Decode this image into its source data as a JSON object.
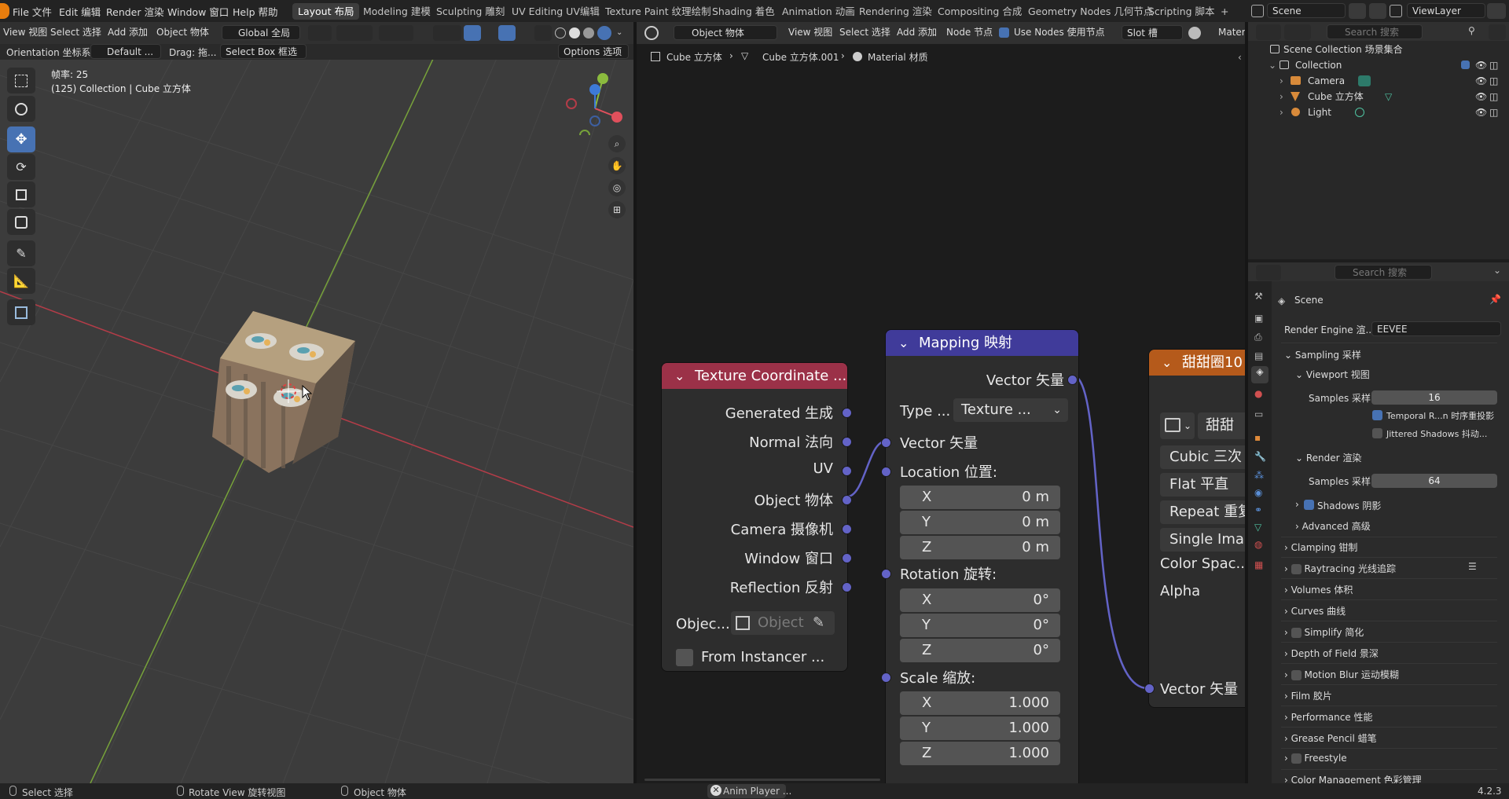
{
  "topbar": {
    "menus": [
      "File 文件",
      "Edit 编辑",
      "Render 渲染",
      "Window 窗口",
      "Help 帮助"
    ],
    "workspaces": [
      "Layout 布局",
      "Modeling 建模",
      "Sculpting 雕刻",
      "UV Editing UV编辑",
      "Texture Paint 纹理绘制",
      "Shading 着色",
      "Animation 动画",
      "Rendering 渲染",
      "Compositing 合成",
      "Geometry Nodes 几何节点",
      "Scripting 脚本"
    ],
    "add_tab": "+",
    "scene_label": "Scene",
    "viewlayer_label": "ViewLayer"
  },
  "viewport_header": {
    "view": "View 视图",
    "select": "Select 选择",
    "add": "Add 添加",
    "object": "Object 物体",
    "transform_orientation": "Global 全局",
    "orientation_label": "Orientation 坐标系:",
    "orientation_value": "Default ...",
    "drag_label": "Drag: 拖...",
    "select_box": "Select Box 框选",
    "options": "Options 选项"
  },
  "viewport": {
    "frame_text": "帧率: 25",
    "context_text": "(125) Collection | Cube 立方体"
  },
  "node_header": {
    "mode": "Object 物体",
    "view": "View 视图",
    "select": "Select 选择",
    "add": "Add 添加",
    "node": "Node 节点",
    "use_nodes": "Use Nodes 使用节点",
    "slot": "Slot 槽",
    "material": "Materia"
  },
  "breadcrumb": {
    "object": "Cube 立方体",
    "mesh": "Cube 立方体.001",
    "material": "Material 材质"
  },
  "nodes": {
    "texcoord": {
      "title": "Texture Coordinate ...",
      "outputs": [
        "Generated 生成",
        "Normal 法向",
        "UV",
        "Object 物体",
        "Camera 摄像机",
        "Window 窗口",
        "Reflection 反射"
      ],
      "object_label": "Objec...",
      "object_placeholder": "Object",
      "from_instancer": "From Instancer ..."
    },
    "mapping": {
      "title": "Mapping 映射",
      "output": "Vector 矢量",
      "type_label": "Type ...",
      "type_value": "Texture ...",
      "vector_in": "Vector 矢量",
      "location_label": "Location 位置:",
      "location": [
        {
          "axis": "X",
          "value": "0 m"
        },
        {
          "axis": "Y",
          "value": "0 m"
        },
        {
          "axis": "Z",
          "value": "0 m"
        }
      ],
      "rotation_label": "Rotation 旋转:",
      "rotation": [
        {
          "axis": "X",
          "value": "0°"
        },
        {
          "axis": "Y",
          "value": "0°"
        },
        {
          "axis": "Z",
          "value": "0°"
        }
      ],
      "scale_label": "Scale 缩放:",
      "scale": [
        {
          "axis": "X",
          "value": "1.000"
        },
        {
          "axis": "Y",
          "value": "1.000"
        },
        {
          "axis": "Z",
          "value": "1.000"
        }
      ]
    },
    "image": {
      "title": "甜甜圈10",
      "image_name": "甜甜",
      "interp": "Cubic 三次",
      "projection": "Flat 平直",
      "extension": "Repeat 重复",
      "source": "Single Ima",
      "colorspace": "Color Spac...",
      "alpha": "Alpha",
      "vector": "Vector 矢量"
    }
  },
  "outliner": {
    "search_placeholder": "Search 搜索",
    "scene_collection": "Scene Collection 场景集合",
    "collection": "Collection",
    "items": [
      "Camera",
      "Cube 立方体",
      "Light"
    ]
  },
  "properties": {
    "search_placeholder": "Search 搜索",
    "scene": "Scene",
    "render_engine_label": "Render Engine 渲...",
    "render_engine_value": "EEVEE",
    "sampling": "Sampling 采样",
    "viewport": "Viewport 视图",
    "samples_label": "Samples 采样",
    "viewport_samples": "16",
    "temporal": "Temporal R...n 时序重投影",
    "jittered": "Jittered Shadows 抖动...",
    "render": "Render 渲染",
    "render_samples": "64",
    "shadows": "Shadows 阴影",
    "advanced": "Advanced 高级",
    "panels": [
      "Clamping 钳制",
      "Raytracing 光线追踪",
      "Volumes 体积",
      "Curves 曲线",
      "Simplify 简化",
      "Depth of Field 景深",
      "Motion Blur 运动模糊",
      "Film 胶片",
      "Performance 性能",
      "Grease Pencil 蜡笔",
      "Freestyle",
      "Color Management 色彩管理"
    ]
  },
  "statusbar": {
    "select": "Select 选择",
    "rotate": "Rotate View 旋转视图",
    "object": "Object 物体",
    "anim_player": "Anim Player ...",
    "version": "4.2.3"
  },
  "colors": {
    "accent": "#4772b3",
    "texcoord_header": "#9b3148",
    "mapping_header": "#403b9a",
    "image_header": "#b55a1b",
    "socket_vector": "#6363c7"
  }
}
